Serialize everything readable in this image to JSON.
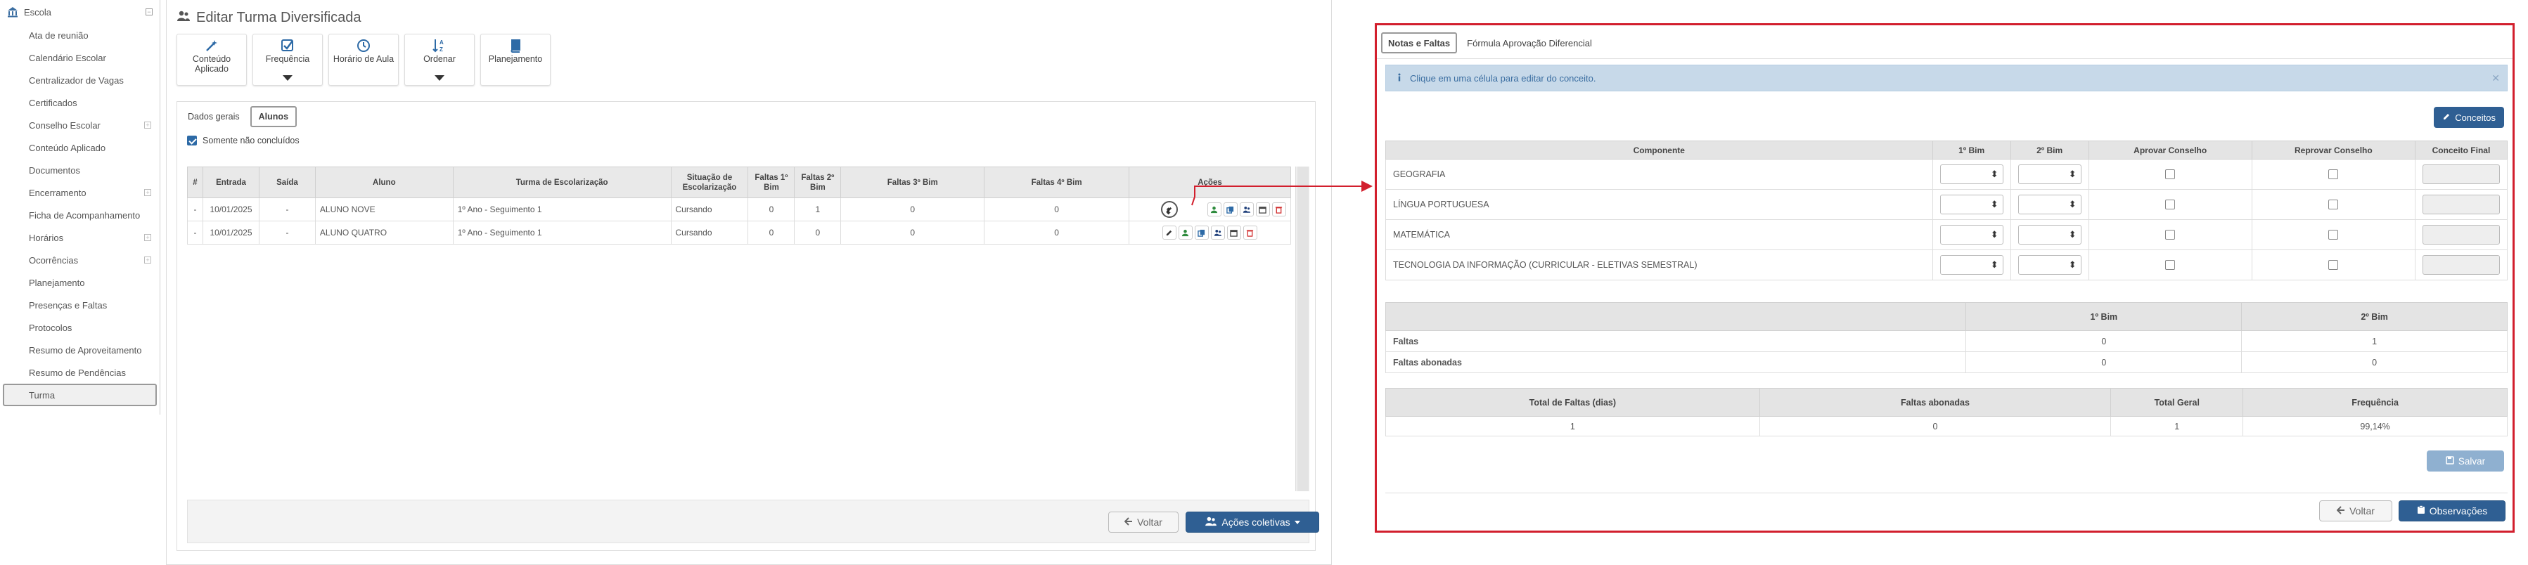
{
  "sidebar": {
    "header": "Escola",
    "items": [
      {
        "label": "Ata de reunião",
        "expandable": false
      },
      {
        "label": "Calendário Escolar",
        "expandable": false
      },
      {
        "label": "Centralizador de Vagas",
        "expandable": false
      },
      {
        "label": "Certificados",
        "expandable": false
      },
      {
        "label": "Conselho Escolar",
        "expandable": true
      },
      {
        "label": "Conteúdo Aplicado",
        "expandable": false
      },
      {
        "label": "Documentos",
        "expandable": false
      },
      {
        "label": "Encerramento",
        "expandable": true
      },
      {
        "label": "Ficha de Acompanhamento",
        "expandable": false
      },
      {
        "label": "Horários",
        "expandable": true
      },
      {
        "label": "Ocorrências",
        "expandable": true
      },
      {
        "label": "Planejamento",
        "expandable": false
      },
      {
        "label": "Presenças e Faltas",
        "expandable": false
      },
      {
        "label": "Protocolos",
        "expandable": false
      },
      {
        "label": "Resumo de Aproveitamento",
        "expandable": false
      },
      {
        "label": "Resumo de Pendências",
        "expandable": false
      },
      {
        "label": "Turma",
        "expandable": false,
        "active": true
      }
    ]
  },
  "page": {
    "title": "Editar Turma Diversificada",
    "toolbar": {
      "conteudo": "Conteúdo Aplicado",
      "frequencia": "Frequência",
      "horario": "Horário de Aula",
      "ordenar": "Ordenar",
      "planejamento": "Planejamento"
    },
    "tabs": {
      "dados": "Dados gerais",
      "alunos": "Alunos"
    },
    "filter_label": "Somente não concluídos",
    "table": {
      "headers": {
        "num": "#",
        "entrada": "Entrada",
        "saida": "Saída",
        "aluno": "Aluno",
        "turma": "Turma de Escolarização",
        "situacao": "Situação de Escolarização",
        "f1": "Faltas 1º Bim",
        "f2": "Faltas 2º Bim",
        "f3": "Faltas 3º Bim",
        "f4": "Faltas 4º Bim",
        "acoes": "Ações"
      },
      "rows": [
        {
          "num": "-",
          "entrada": "10/01/2025",
          "saida": "-",
          "aluno": "ALUNO NOVE",
          "turma": "1º Ano - Seguimento 1",
          "situacao": "Cursando",
          "f1": "0",
          "f2": "1",
          "f3": "0",
          "f4": "0"
        },
        {
          "num": "-",
          "entrada": "10/01/2025",
          "saida": "-",
          "aluno": "ALUNO QUATRO",
          "turma": "1º Ano - Seguimento 1",
          "situacao": "Cursando",
          "f1": "0",
          "f2": "0",
          "f3": "0",
          "f4": "0"
        }
      ]
    },
    "buttons": {
      "voltar": "Voltar",
      "acoes_coletivas": "Ações coletivas"
    }
  },
  "detail": {
    "tabs": {
      "notas": "Notas e Faltas",
      "formula": "Fórmula Aprovação Diferencial"
    },
    "alert": "Clique em uma célula para editar do conceito.",
    "conceitos_button": "Conceitos",
    "grades": {
      "headers": {
        "componente": "Componente",
        "b1": "1º Bim",
        "b2": "2º Bim",
        "aprovar": "Aprovar Conselho",
        "reprovar": "Reprovar Conselho",
        "conceito": "Conceito Final"
      },
      "rows": [
        {
          "componente": "GEOGRAFIA"
        },
        {
          "componente": "LÍNGUA PORTUGUESA"
        },
        {
          "componente": "MATEMÁTICA"
        },
        {
          "componente": "TECNOLOGIA DA INFORMAÇÃO (CURRICULAR - ELETIVAS SEMESTRAL)"
        }
      ]
    },
    "absences": {
      "headers": {
        "b1": "1º Bim",
        "b2": "2º Bim"
      },
      "rows": [
        {
          "label": "Faltas",
          "b1": "0",
          "b2": "1"
        },
        {
          "label": "Faltas abonadas",
          "b1": "0",
          "b2": "0"
        }
      ]
    },
    "totals": {
      "headers": {
        "total_faltas": "Total de Faltas (dias)",
        "abonadas": "Faltas abonadas",
        "total_geral": "Total Geral",
        "frequencia": "Frequência"
      },
      "values": {
        "total_faltas": "1",
        "abonadas": "0",
        "total_geral": "1",
        "frequencia": "99,14%"
      }
    },
    "salvar": "Salvar",
    "voltar": "Voltar",
    "observacoes": "Observações"
  },
  "colors": {
    "primary": "#2f5f93",
    "highlight_border": "#d21f2d",
    "alert_bg": "#c7d9e9",
    "disabled_primary": "#8fb0d0"
  }
}
